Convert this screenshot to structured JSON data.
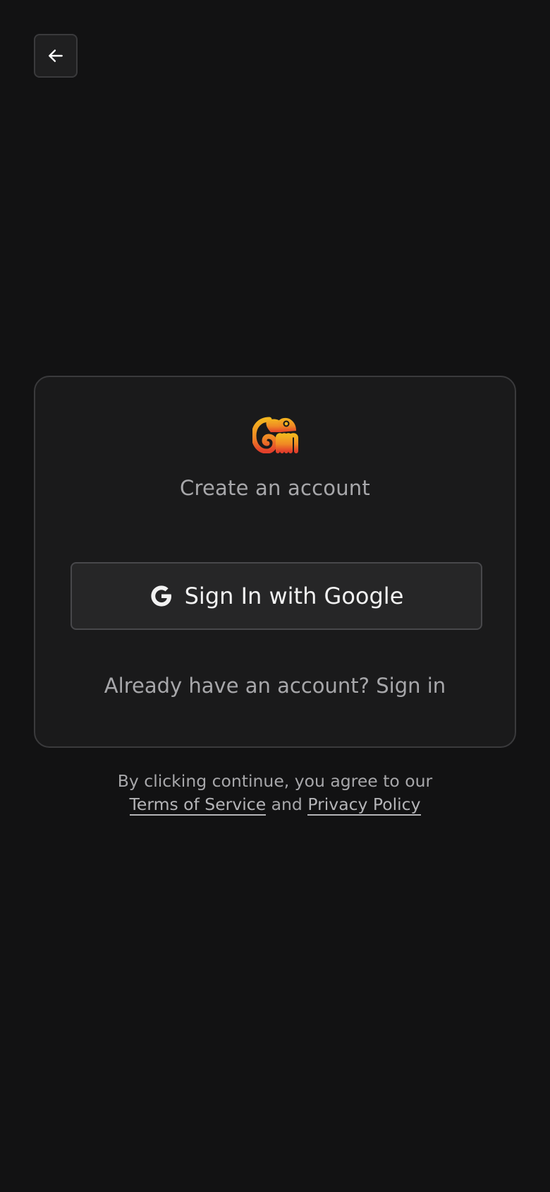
{
  "nav": {
    "back_icon": "arrow-left-icon"
  },
  "card": {
    "logo_icon": "chameleon-logo",
    "title": "Create an account",
    "google_button": {
      "icon": "google-g-icon",
      "label": "Sign In with Google"
    },
    "signin_prompt": "Already have an account?",
    "signin_link": "Sign in"
  },
  "legal": {
    "prefix": "By clicking continue, you agree to our",
    "terms_link": "Terms of Service",
    "conjunction": "and",
    "privacy_link": "Privacy Policy"
  },
  "colors": {
    "background": "#121213",
    "card": "#1a1a1b",
    "logo_top": "#f0a81e",
    "logo_bottom": "#e8452c"
  }
}
